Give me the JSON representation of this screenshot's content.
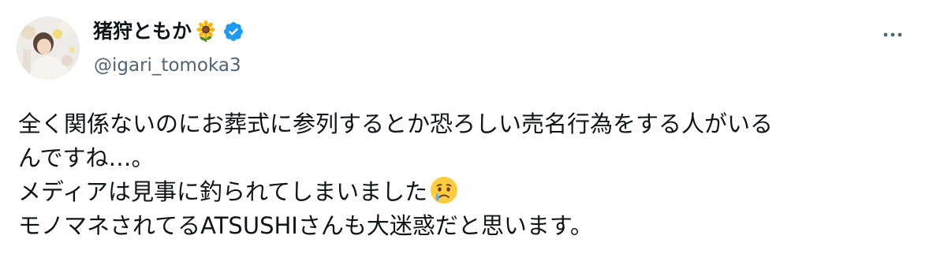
{
  "author": {
    "display_name": "猪狩ともか",
    "handle": "@igari_tomoka3",
    "name_emoji": "sunflower-icon",
    "verified_badge": "verified-icon",
    "badge_color": "#1d9bf0"
  },
  "menu": {
    "more_icon": "more-options-icon"
  },
  "tweet": {
    "lines": [
      "全く関係ないのにお葬式に参列するとか恐ろしい売名行為をする人がいる",
      "んですね…。",
      "メディアは見事に釣られてしまいました",
      "モノマネされてるATSUSHIさんも大迷惑だと思います。"
    ],
    "inline_emoji": "crying-face-emoji"
  },
  "colors": {
    "text_primary": "#0f1419",
    "text_secondary": "#536471",
    "accent": "#1d9bf0"
  }
}
